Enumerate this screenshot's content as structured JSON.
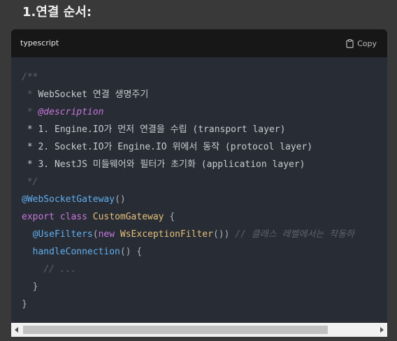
{
  "heading": {
    "text": "1.연결 순서:"
  },
  "code_block": {
    "language": "typescript",
    "copy_label": "Copy",
    "lines": [
      [
        {
          "t": "/**",
          "c": "cm"
        }
      ],
      [
        {
          "t": " * ",
          "c": "cm"
        },
        {
          "t": "WebSocket 연결 생명주기",
          "c": "txt"
        }
      ],
      [
        {
          "t": " * ",
          "c": "cm"
        },
        {
          "t": "@description",
          "c": "tag"
        }
      ],
      [
        {
          "t": " * ",
          "c": "txt"
        },
        {
          "t": "1. Engine.IO가 먼저 연결을 수립 (transport layer)",
          "c": "txt"
        }
      ],
      [
        {
          "t": " * ",
          "c": "txt"
        },
        {
          "t": "2. Socket.IO가 Engine.IO 위에서 동작 (protocol layer)",
          "c": "txt"
        }
      ],
      [
        {
          "t": " * ",
          "c": "txt"
        },
        {
          "t": "3. NestJS 미들웨어와 필터가 초기화 (application layer)",
          "c": "txt"
        }
      ],
      [
        {
          "t": " */",
          "c": "cm"
        }
      ],
      [
        {
          "t": "@WebSocketGateway",
          "c": "dec"
        },
        {
          "t": "()",
          "c": "pn"
        }
      ],
      [
        {
          "t": "export",
          "c": "kw"
        },
        {
          "t": " ",
          "c": "pn"
        },
        {
          "t": "class",
          "c": "kw"
        },
        {
          "t": " ",
          "c": "pn"
        },
        {
          "t": "CustomGateway",
          "c": "cls"
        },
        {
          "t": " {",
          "c": "pn"
        }
      ],
      [
        {
          "t": "  ",
          "c": "pn"
        },
        {
          "t": "@UseFilters",
          "c": "dec"
        },
        {
          "t": "(",
          "c": "pn"
        },
        {
          "t": "new",
          "c": "kw"
        },
        {
          "t": " ",
          "c": "pn"
        },
        {
          "t": "WsExceptionFilter",
          "c": "cls"
        },
        {
          "t": "()) ",
          "c": "pn"
        },
        {
          "t": "// 클래스 레벨에서는 작동하",
          "c": "cm"
        }
      ],
      [
        {
          "t": "  ",
          "c": "pn"
        },
        {
          "t": "handleConnection",
          "c": "fn"
        },
        {
          "t": "() {",
          "c": "pn"
        }
      ],
      [
        {
          "t": "    ",
          "c": "pn"
        },
        {
          "t": "// ...",
          "c": "cm"
        }
      ],
      [
        {
          "t": "  }",
          "c": "pn"
        }
      ],
      [
        {
          "t": "}",
          "c": "pn"
        }
      ]
    ]
  },
  "icons": {
    "copy": "clipboard-icon",
    "scroll_left": "scroll-left-arrow-icon",
    "scroll_right": "scroll-right-arrow-icon"
  },
  "colors": {
    "page_background": "#393939",
    "code_background": "#282c34",
    "header_background": "#171717",
    "comment": "#5c6370",
    "keyword": "#c678dd",
    "class_name": "#e5c07b",
    "function": "#61afef",
    "decorator": "#61afef",
    "scrollbar_track": "#f1f1f1",
    "scrollbar_thumb": "#c1c1c1"
  },
  "scrollbar": {
    "position_fraction": 0.0,
    "visible_fraction": 0.84
  }
}
